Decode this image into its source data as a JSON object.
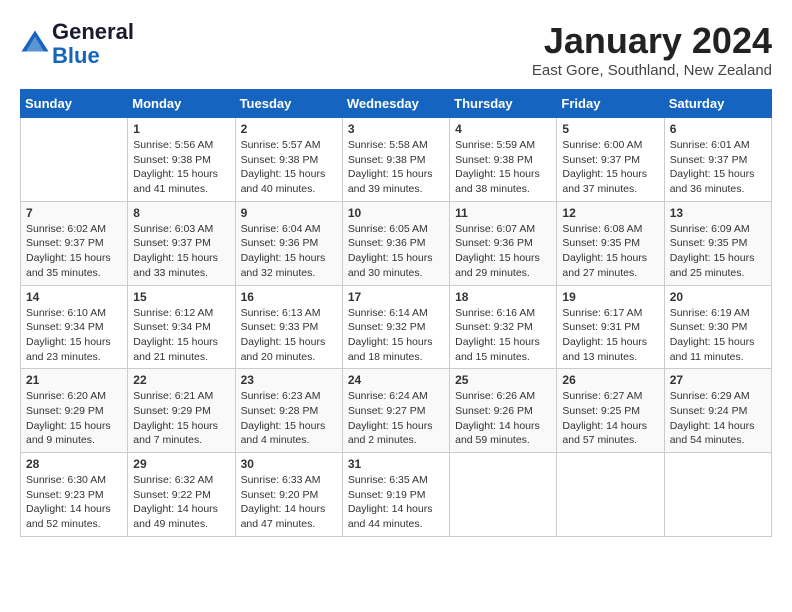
{
  "header": {
    "title": "January 2024",
    "location": "East Gore, Southland, New Zealand",
    "logo_line1": "General",
    "logo_line2": "Blue"
  },
  "days_of_week": [
    "Sunday",
    "Monday",
    "Tuesday",
    "Wednesday",
    "Thursday",
    "Friday",
    "Saturday"
  ],
  "weeks": [
    [
      {
        "day": null,
        "text": ""
      },
      {
        "day": "1",
        "text": "Sunrise: 5:56 AM\nSunset: 9:38 PM\nDaylight: 15 hours\nand 41 minutes."
      },
      {
        "day": "2",
        "text": "Sunrise: 5:57 AM\nSunset: 9:38 PM\nDaylight: 15 hours\nand 40 minutes."
      },
      {
        "day": "3",
        "text": "Sunrise: 5:58 AM\nSunset: 9:38 PM\nDaylight: 15 hours\nand 39 minutes."
      },
      {
        "day": "4",
        "text": "Sunrise: 5:59 AM\nSunset: 9:38 PM\nDaylight: 15 hours\nand 38 minutes."
      },
      {
        "day": "5",
        "text": "Sunrise: 6:00 AM\nSunset: 9:37 PM\nDaylight: 15 hours\nand 37 minutes."
      },
      {
        "day": "6",
        "text": "Sunrise: 6:01 AM\nSunset: 9:37 PM\nDaylight: 15 hours\nand 36 minutes."
      }
    ],
    [
      {
        "day": "7",
        "text": "Sunrise: 6:02 AM\nSunset: 9:37 PM\nDaylight: 15 hours\nand 35 minutes."
      },
      {
        "day": "8",
        "text": "Sunrise: 6:03 AM\nSunset: 9:37 PM\nDaylight: 15 hours\nand 33 minutes."
      },
      {
        "day": "9",
        "text": "Sunrise: 6:04 AM\nSunset: 9:36 PM\nDaylight: 15 hours\nand 32 minutes."
      },
      {
        "day": "10",
        "text": "Sunrise: 6:05 AM\nSunset: 9:36 PM\nDaylight: 15 hours\nand 30 minutes."
      },
      {
        "day": "11",
        "text": "Sunrise: 6:07 AM\nSunset: 9:36 PM\nDaylight: 15 hours\nand 29 minutes."
      },
      {
        "day": "12",
        "text": "Sunrise: 6:08 AM\nSunset: 9:35 PM\nDaylight: 15 hours\nand 27 minutes."
      },
      {
        "day": "13",
        "text": "Sunrise: 6:09 AM\nSunset: 9:35 PM\nDaylight: 15 hours\nand 25 minutes."
      }
    ],
    [
      {
        "day": "14",
        "text": "Sunrise: 6:10 AM\nSunset: 9:34 PM\nDaylight: 15 hours\nand 23 minutes."
      },
      {
        "day": "15",
        "text": "Sunrise: 6:12 AM\nSunset: 9:34 PM\nDaylight: 15 hours\nand 21 minutes."
      },
      {
        "day": "16",
        "text": "Sunrise: 6:13 AM\nSunset: 9:33 PM\nDaylight: 15 hours\nand 20 minutes."
      },
      {
        "day": "17",
        "text": "Sunrise: 6:14 AM\nSunset: 9:32 PM\nDaylight: 15 hours\nand 18 minutes."
      },
      {
        "day": "18",
        "text": "Sunrise: 6:16 AM\nSunset: 9:32 PM\nDaylight: 15 hours\nand 15 minutes."
      },
      {
        "day": "19",
        "text": "Sunrise: 6:17 AM\nSunset: 9:31 PM\nDaylight: 15 hours\nand 13 minutes."
      },
      {
        "day": "20",
        "text": "Sunrise: 6:19 AM\nSunset: 9:30 PM\nDaylight: 15 hours\nand 11 minutes."
      }
    ],
    [
      {
        "day": "21",
        "text": "Sunrise: 6:20 AM\nSunset: 9:29 PM\nDaylight: 15 hours\nand 9 minutes."
      },
      {
        "day": "22",
        "text": "Sunrise: 6:21 AM\nSunset: 9:29 PM\nDaylight: 15 hours\nand 7 minutes."
      },
      {
        "day": "23",
        "text": "Sunrise: 6:23 AM\nSunset: 9:28 PM\nDaylight: 15 hours\nand 4 minutes."
      },
      {
        "day": "24",
        "text": "Sunrise: 6:24 AM\nSunset: 9:27 PM\nDaylight: 15 hours\nand 2 minutes."
      },
      {
        "day": "25",
        "text": "Sunrise: 6:26 AM\nSunset: 9:26 PM\nDaylight: 14 hours\nand 59 minutes."
      },
      {
        "day": "26",
        "text": "Sunrise: 6:27 AM\nSunset: 9:25 PM\nDaylight: 14 hours\nand 57 minutes."
      },
      {
        "day": "27",
        "text": "Sunrise: 6:29 AM\nSunset: 9:24 PM\nDaylight: 14 hours\nand 54 minutes."
      }
    ],
    [
      {
        "day": "28",
        "text": "Sunrise: 6:30 AM\nSunset: 9:23 PM\nDaylight: 14 hours\nand 52 minutes."
      },
      {
        "day": "29",
        "text": "Sunrise: 6:32 AM\nSunset: 9:22 PM\nDaylight: 14 hours\nand 49 minutes."
      },
      {
        "day": "30",
        "text": "Sunrise: 6:33 AM\nSunset: 9:20 PM\nDaylight: 14 hours\nand 47 minutes."
      },
      {
        "day": "31",
        "text": "Sunrise: 6:35 AM\nSunset: 9:19 PM\nDaylight: 14 hours\nand 44 minutes."
      },
      {
        "day": null,
        "text": ""
      },
      {
        "day": null,
        "text": ""
      },
      {
        "day": null,
        "text": ""
      }
    ]
  ]
}
